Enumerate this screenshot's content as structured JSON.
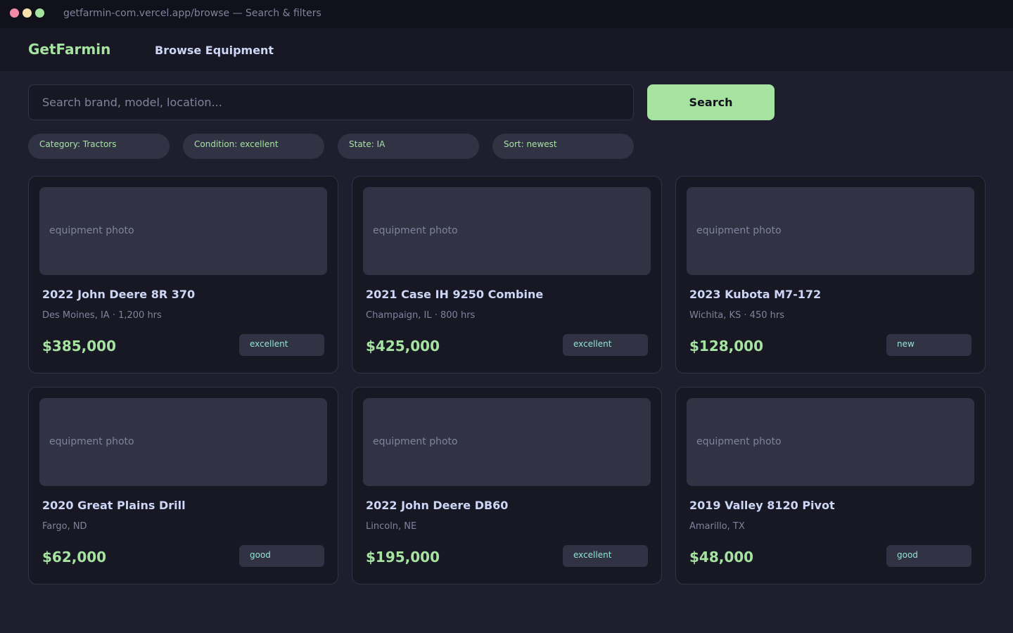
{
  "window": {
    "title": "getfarmin-com.vercel.app/browse — Search & filters"
  },
  "nav": {
    "brand": "GetFarmin",
    "link": "Browse Equipment"
  },
  "search": {
    "placeholder": "Search brand, model, location...",
    "value": "",
    "button_label": "Search"
  },
  "filters": [
    {
      "label": "Category: Tractors"
    },
    {
      "label": "Condition: excellent"
    },
    {
      "label": "State: IA"
    },
    {
      "label": "Sort: newest"
    }
  ],
  "listings": [
    {
      "photo_label": "equipment photo",
      "title": "2022 John Deere 8R 370",
      "subtitle": "Des Moines, IA · 1,200 hrs",
      "price": "$385,000",
      "condition": "excellent"
    },
    {
      "photo_label": "equipment photo",
      "title": "2021 Case IH 9250 Combine",
      "subtitle": "Champaign, IL · 800 hrs",
      "price": "$425,000",
      "condition": "excellent"
    },
    {
      "photo_label": "equipment photo",
      "title": "2023 Kubota M7-172",
      "subtitle": "Wichita, KS · 450 hrs",
      "price": "$128,000",
      "condition": "new"
    },
    {
      "photo_label": "equipment photo",
      "title": "2020 Great Plains Drill",
      "subtitle": "Fargo, ND",
      "price": "$62,000",
      "condition": "good"
    },
    {
      "photo_label": "equipment photo",
      "title": "2022 John Deere DB60",
      "subtitle": "Lincoln, NE",
      "price": "$195,000",
      "condition": "excellent"
    },
    {
      "photo_label": "equipment photo",
      "title": "2019 Valley 8120 Pivot",
      "subtitle": "Amarillo, TX",
      "price": "$48,000",
      "condition": "good"
    }
  ],
  "colors": {
    "background": "#1e1e2e",
    "accent": "#a6e3a1",
    "badge_text": "#94e2d5"
  }
}
